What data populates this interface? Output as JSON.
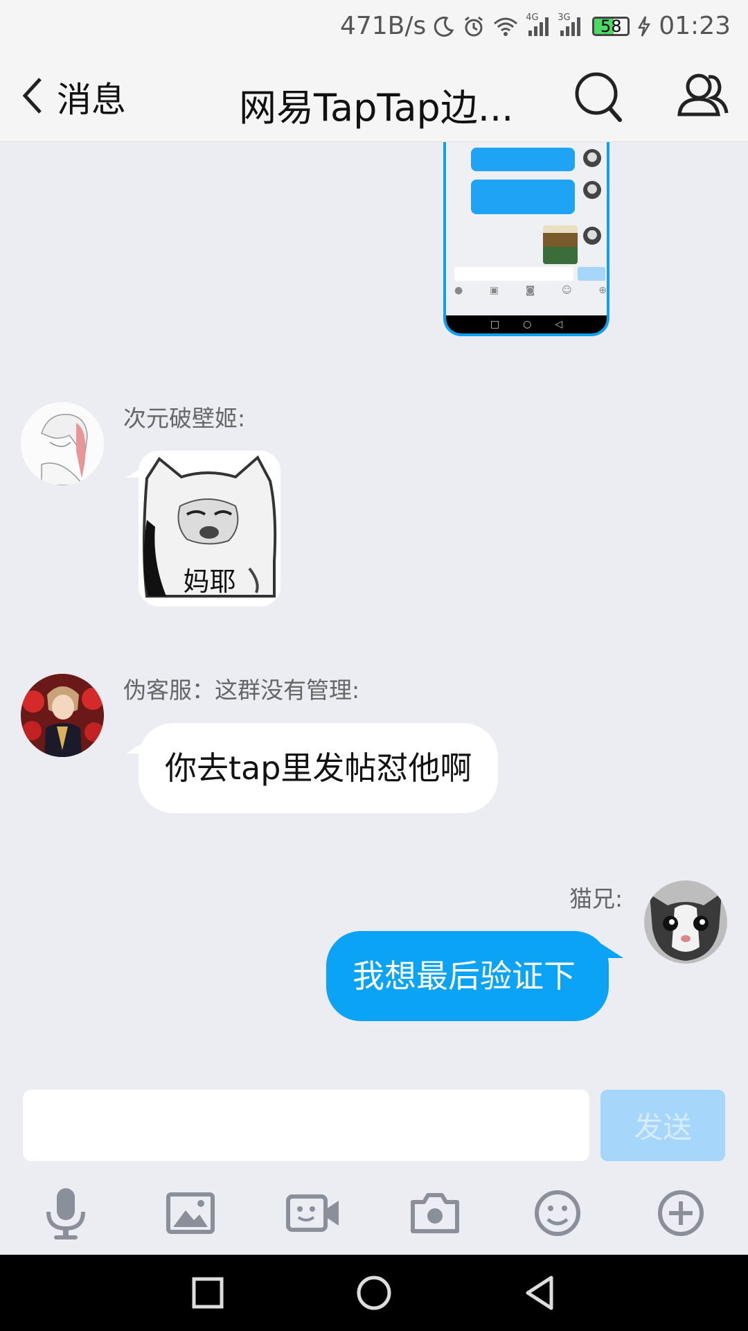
{
  "status_bar": {
    "net_speed": "471B/s",
    "signal_1": "4G",
    "signal_2": "3G",
    "battery": "58",
    "time": "01:23"
  },
  "header": {
    "back_label": "消息",
    "title": "网易TapTap边..."
  },
  "messages": [
    {
      "sender": "次元破壁姬:",
      "type": "sticker",
      "sticker_caption": "妈耶"
    },
    {
      "sender": "伪客服：这群没有管理:",
      "type": "text",
      "text": "你去tap里发帖怼他啊"
    },
    {
      "sender": "猫兄:",
      "type": "text",
      "outgoing": true,
      "text": "我想最后验证下"
    }
  ],
  "input": {
    "value": "",
    "send_label": "发送"
  },
  "toolbar": {
    "icons": [
      "microphone-icon",
      "image-icon",
      "video-call-icon",
      "camera-icon",
      "emoji-icon",
      "plus-icon"
    ]
  },
  "colors": {
    "accent": "#0aa3f5",
    "send_disabled": "#a6d7fb",
    "background": "#ebedf2"
  }
}
